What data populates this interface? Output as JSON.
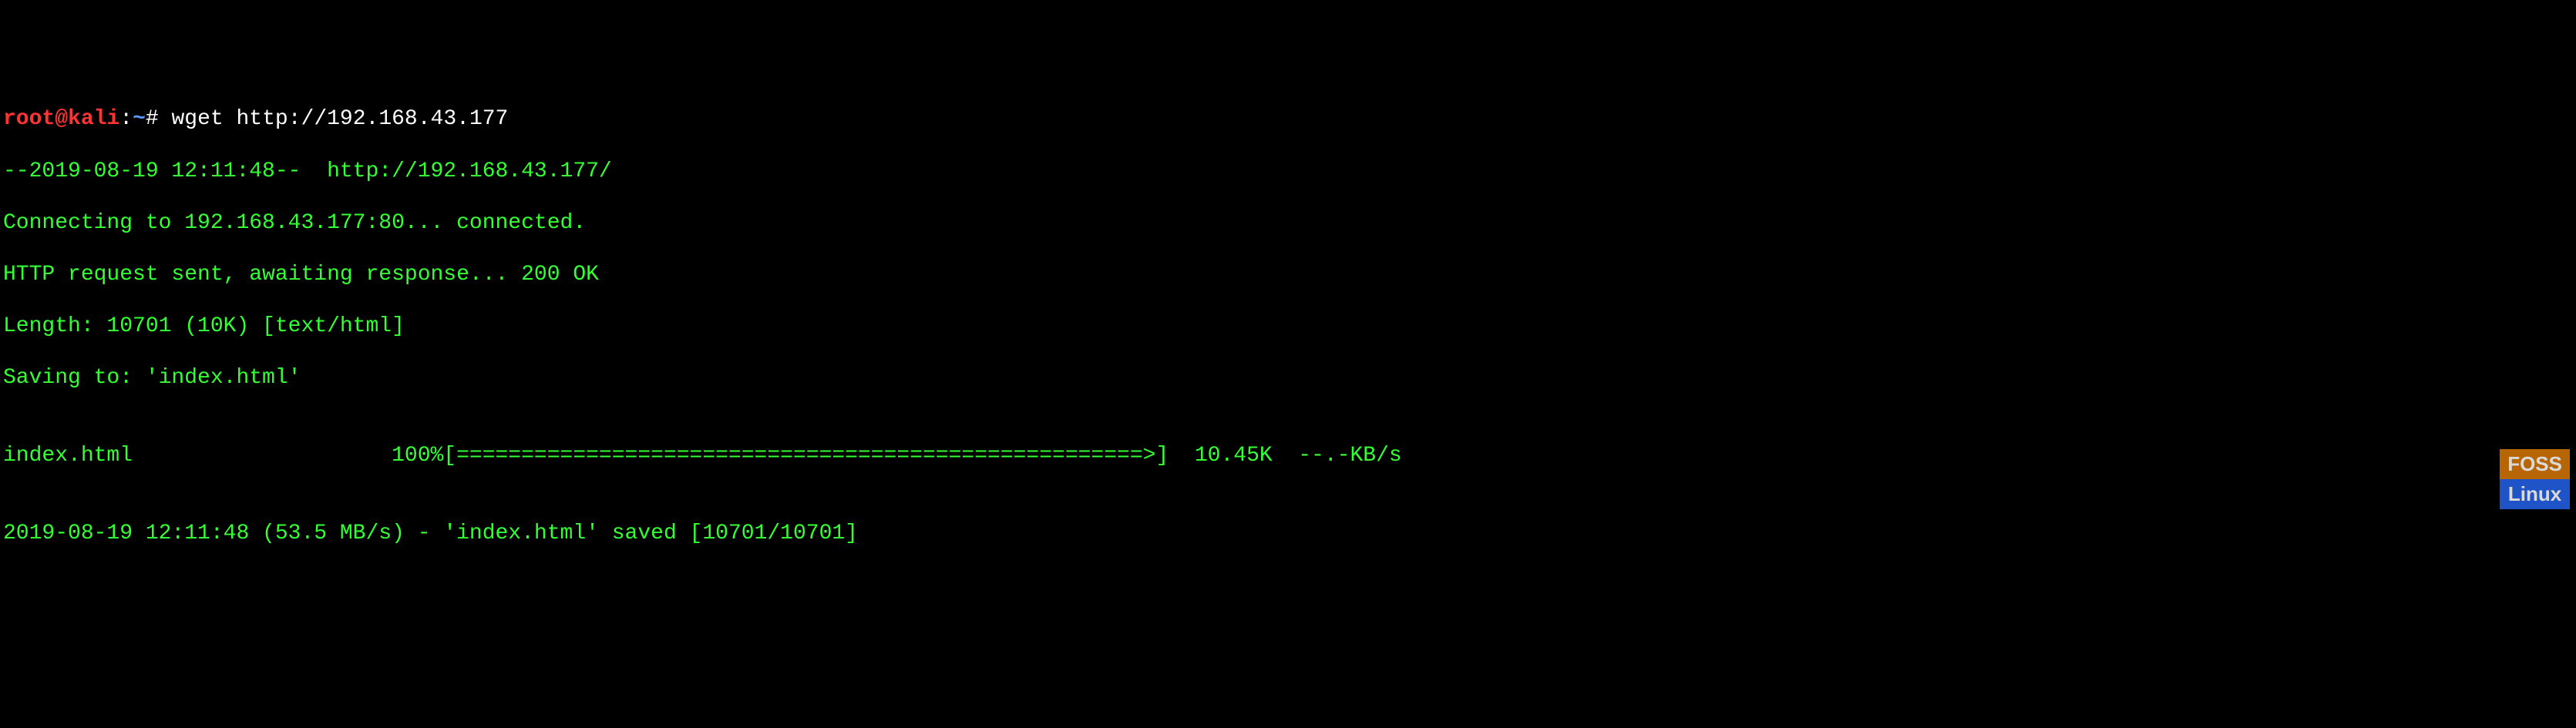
{
  "prompt": {
    "user": "root",
    "at": "@",
    "host": "kali",
    "colon": ":",
    "path": "~",
    "hash": "# "
  },
  "command": "wget http://192.168.43.177",
  "output": {
    "line1": "--2019-08-19 12:11:48--  http://192.168.43.177/",
    "line2": "Connecting to 192.168.43.177:80... connected.",
    "line3": "HTTP request sent, awaiting response... 200 OK",
    "line4": "Length: 10701 (10K) [text/html]",
    "line5": "Saving to: 'index.html'",
    "line6": "",
    "line7": "index.html                    100%[=====================================================>]  10.45K  --.-KB/s",
    "line8": "",
    "line9": "2019-08-19 12:11:48 (53.5 MB/s) - 'index.html' saved [10701/10701]"
  },
  "watermark": {
    "top": "FOSS",
    "bottom": "Linux"
  }
}
